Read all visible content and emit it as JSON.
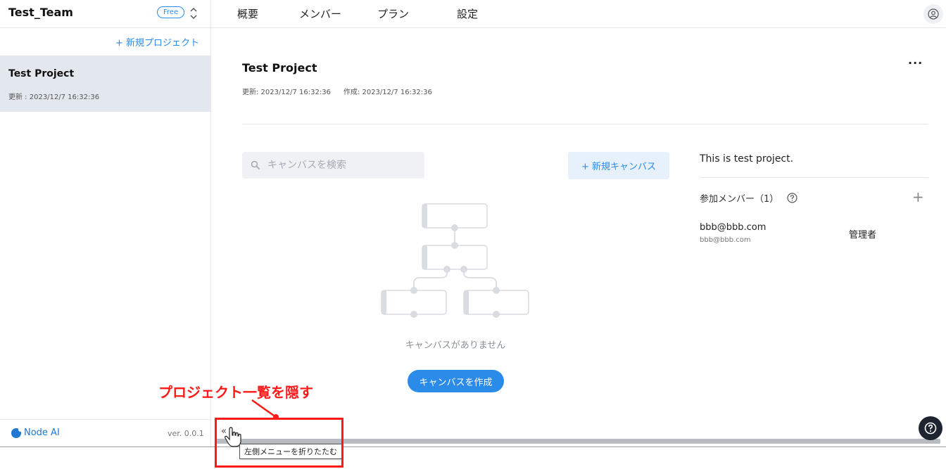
{
  "sidebar": {
    "team_name": "Test_Team",
    "plan_badge": "Free",
    "new_project_label": "+ 新規プロジェクト",
    "projects": [
      {
        "title": "Test Project",
        "updated": "更新 : 2023/12/7 16:32:36"
      }
    ],
    "footer": {
      "brand": "Node AI",
      "version": "ver. 0.0.1"
    }
  },
  "nav": {
    "tabs": [
      "概要",
      "メンバー",
      "プラン",
      "設定"
    ],
    "user_icon": "user-circle-icon"
  },
  "project": {
    "title": "Test Project",
    "updated": "更新: 2023/12/7 16:32:36",
    "created": "作成: 2023/12/7 16:32:36",
    "more_label": "···",
    "description": "This is test project."
  },
  "canvas": {
    "search_placeholder": "キャンバスを検索",
    "new_canvas_label": "+ 新規キャンバス",
    "empty_text": "キャンバスがありません",
    "create_label": "キャンバスを作成"
  },
  "members": {
    "heading": "参加メンバー（1）",
    "add_label": "+",
    "list": [
      {
        "email": "bbb@bbb.com",
        "email_sub": "bbb@bbb.com",
        "role": "管理者"
      }
    ]
  },
  "bottom": {
    "collapse_label": "«",
    "tooltip": "左側メニューを折りたたむ",
    "help_icon": "question-circle-icon"
  },
  "annotation": {
    "text": "プロジェクト一覧を隠す",
    "color": "#ff1a1a"
  },
  "colors": {
    "accent": "#2a8be8",
    "selected_bg": "#e3e8ef"
  }
}
